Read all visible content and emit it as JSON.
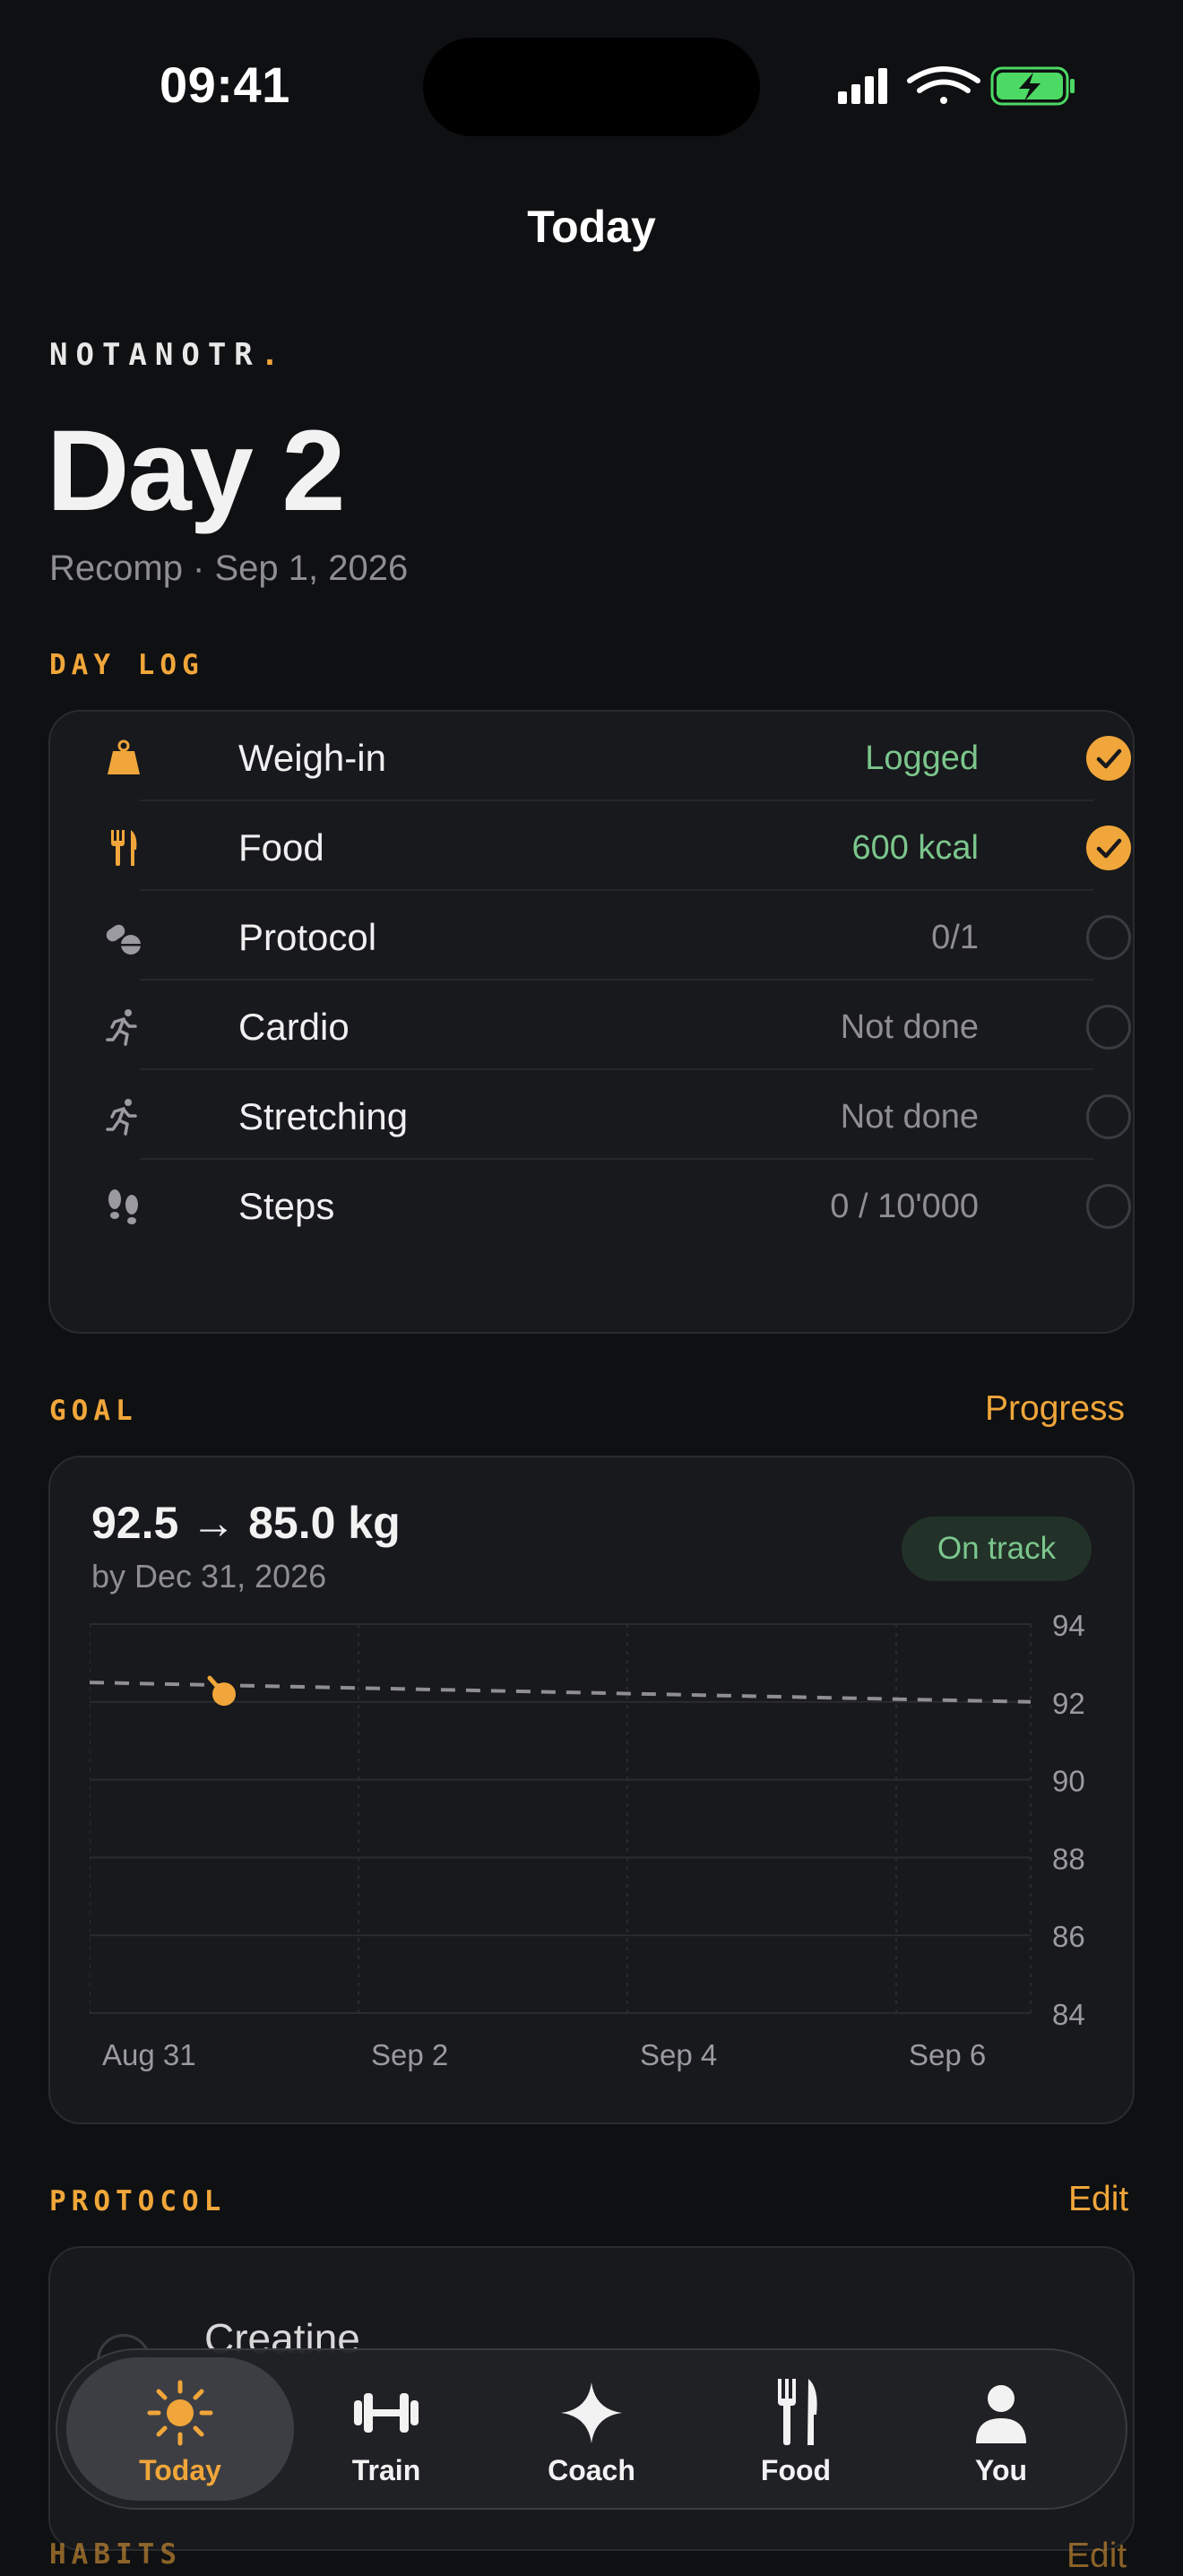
{
  "status_bar": {
    "time": "09:41"
  },
  "nav": {
    "title": "Today"
  },
  "brand": {
    "name": "NOTANOTR",
    "dot": "."
  },
  "header": {
    "day_title": "Day 2",
    "subtitle": "Recomp · Sep 1, 2026"
  },
  "day_log": {
    "label": "DAY LOG",
    "rows": [
      {
        "label": "Weigh-in",
        "value": "Logged",
        "done": true,
        "icon": "weight-icon"
      },
      {
        "label": "Food",
        "value": "600 kcal",
        "done": true,
        "icon": "fork-knife-icon"
      },
      {
        "label": "Protocol",
        "value": "0/1",
        "done": false,
        "icon": "pills-icon"
      },
      {
        "label": "Cardio",
        "value": "Not done",
        "done": false,
        "icon": "running-icon"
      },
      {
        "label": "Stretching",
        "value": "Not done",
        "done": false,
        "icon": "running-icon"
      },
      {
        "label": "Steps",
        "value": "0 / 10'000",
        "done": false,
        "icon": "footsteps-icon"
      }
    ]
  },
  "goal": {
    "label": "GOAL",
    "link": "Progress",
    "summary": "92.5 → 85.0 kg",
    "by": "by Dec 31, 2026",
    "badge": "On track"
  },
  "chart_data": {
    "type": "line",
    "x_ticks": [
      "Aug 31",
      "Sep 2",
      "Sep 4",
      "Sep 6"
    ],
    "y_ticks": [
      "94",
      "92",
      "90",
      "88",
      "86",
      "84"
    ],
    "ylim": [
      84,
      94
    ],
    "xlim": [
      "Aug 31",
      "Sep 7"
    ],
    "grid": true,
    "series": [
      {
        "style": "dashed",
        "x": [
          "Aug 31",
          "Sep 7"
        ],
        "values": [
          92.5,
          92.0
        ]
      },
      {
        "style": "point",
        "x": [
          "Sep 1"
        ],
        "values": [
          92.2
        ]
      }
    ]
  },
  "protocol": {
    "label": "PROTOCOL",
    "link": "Edit",
    "items": [
      {
        "name": "Creatine"
      }
    ]
  },
  "habits": {
    "label": "HABITS",
    "link": "Edit"
  },
  "tabs": [
    {
      "label": "Today",
      "icon": "sun-icon",
      "active": true
    },
    {
      "label": "Train",
      "icon": "dumbbell-icon",
      "active": false
    },
    {
      "label": "Coach",
      "icon": "sparkle-icon",
      "active": false
    },
    {
      "label": "Food",
      "icon": "fork-knife-icon",
      "active": false
    },
    {
      "label": "You",
      "icon": "person-icon",
      "active": false
    }
  ],
  "colors": {
    "accent": "#f0a63a",
    "success": "#7bc68c",
    "background": "#0f1012",
    "card": "#18191c"
  }
}
